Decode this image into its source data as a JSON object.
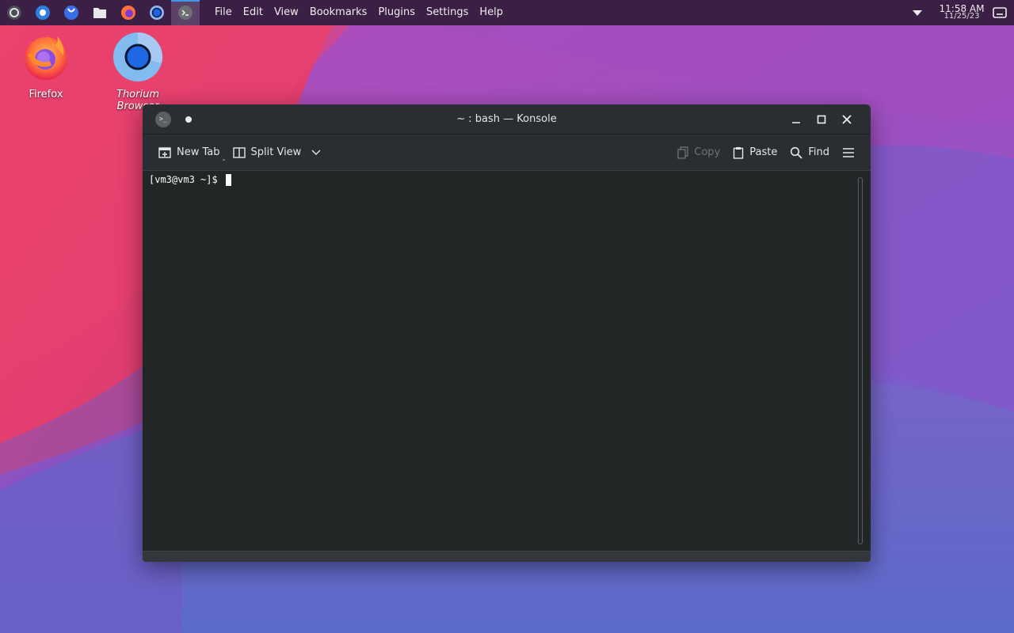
{
  "panel": {
    "tasks": [
      "launcher-icon",
      "discover-icon",
      "info-center-icon",
      "files-icon",
      "firefox-icon",
      "thorium-icon",
      "konsole-icon"
    ],
    "menu": [
      "File",
      "Edit",
      "View",
      "Bookmarks",
      "Plugins",
      "Settings",
      "Help"
    ],
    "clock": {
      "time": "11:58 AM",
      "date": "11/25/23"
    }
  },
  "desktop": {
    "icons": [
      {
        "label": "Firefox",
        "icon": "firefox-icon"
      },
      {
        "label": "Thorium Browser",
        "icon": "thorium-icon"
      }
    ]
  },
  "window": {
    "title": "~ : bash — Konsole",
    "toolbar": {
      "new_tab": "New Tab",
      "split_view": "Split View",
      "copy": "Copy",
      "paste": "Paste",
      "find": "Find"
    },
    "terminal": {
      "prompt": "[vm3@vm3 ~]$"
    }
  },
  "colors": {
    "panel_bg": "#3b1f45",
    "window_bg": "#232629",
    "accent": "#3d9ae8"
  }
}
